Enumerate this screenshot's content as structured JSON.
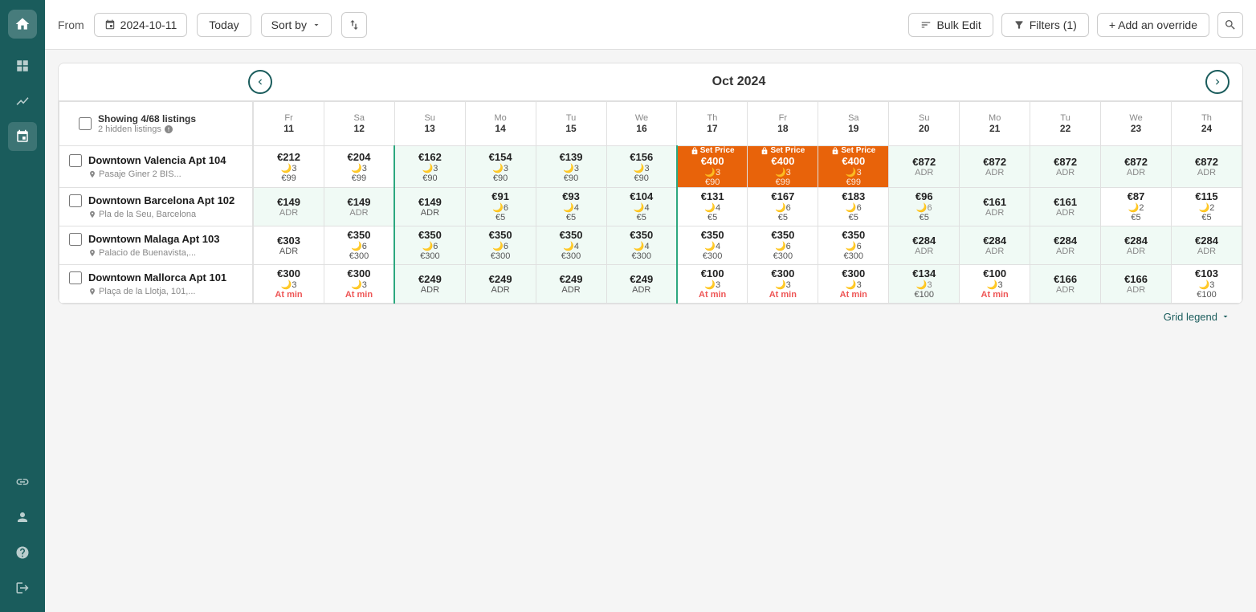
{
  "sidebar": {
    "logo_icon": "home-icon",
    "items": [
      {
        "name": "dashboard-icon",
        "icon": "⊞",
        "active": false
      },
      {
        "name": "chart-icon",
        "icon": "📈",
        "active": false
      },
      {
        "name": "calendar-icon",
        "icon": "📅",
        "active": true
      },
      {
        "name": "link-icon",
        "icon": "🔗",
        "active": false
      },
      {
        "name": "user-icon",
        "icon": "👤",
        "active": false
      },
      {
        "name": "help-icon",
        "icon": "?",
        "active": false
      },
      {
        "name": "logout-icon",
        "icon": "→",
        "active": false
      }
    ]
  },
  "topbar": {
    "from_label": "From",
    "date_value": "2024-10-11",
    "today_label": "Today",
    "sort_by_label": "Sort by",
    "bulk_edit_label": "Bulk Edit",
    "filters_label": "Filters (1)",
    "add_override_label": "+ Add an override"
  },
  "calendar": {
    "month_title": "Oct 2024",
    "days": [
      {
        "name": "Fr",
        "num": "11"
      },
      {
        "name": "Sa",
        "num": "12"
      },
      {
        "name": "Su",
        "num": "13"
      },
      {
        "name": "Mo",
        "num": "14"
      },
      {
        "name": "Tu",
        "num": "15"
      },
      {
        "name": "We",
        "num": "16"
      },
      {
        "name": "Th",
        "num": "17"
      },
      {
        "name": "Fr",
        "num": "18"
      },
      {
        "name": "Sa",
        "num": "19"
      },
      {
        "name": "Su",
        "num": "20"
      },
      {
        "name": "Mo",
        "num": "21"
      },
      {
        "name": "Tu",
        "num": "22"
      },
      {
        "name": "We",
        "num": "23"
      },
      {
        "name": "Th",
        "num": "24"
      }
    ],
    "listing_header": "Showing 4/68 listings",
    "listing_subheader": "2 hidden listings",
    "listings": [
      {
        "id": "valencia-104",
        "name": "Downtown Valencia Apt 104",
        "address": "Pasaje Giner 2 BIS...",
        "prices": [
          {
            "main": "€212",
            "sub": "🌙3",
            "third": "€99",
            "type": "normal"
          },
          {
            "main": "€204",
            "sub": "🌙3",
            "third": "€99",
            "type": "normal"
          },
          {
            "main": "€162",
            "sub": "🌙3",
            "third": "€90",
            "type": "period"
          },
          {
            "main": "€154",
            "sub": "🌙3",
            "third": "€90",
            "type": "period"
          },
          {
            "main": "€139",
            "sub": "🌙3",
            "third": "€90",
            "type": "period"
          },
          {
            "main": "€156",
            "sub": "🌙3",
            "third": "€90",
            "type": "period"
          },
          {
            "main": "€400",
            "sub": "🌙3",
            "third": "€90",
            "type": "setprice",
            "label": "Set Price"
          },
          {
            "main": "€400",
            "sub": "🌙3",
            "third": "€99",
            "type": "setprice",
            "label": "Set Price"
          },
          {
            "main": "€400",
            "sub": "🌙3",
            "third": "€99",
            "type": "setprice",
            "label": "Set Price"
          },
          {
            "main": "€872",
            "sub": "ADR",
            "third": "",
            "type": "adr"
          },
          {
            "main": "€872",
            "sub": "ADR",
            "third": "",
            "type": "adr"
          },
          {
            "main": "€872",
            "sub": "ADR",
            "third": "",
            "type": "adr"
          },
          {
            "main": "€872",
            "sub": "ADR",
            "third": "",
            "type": "adr"
          },
          {
            "main": "€872",
            "sub": "ADR",
            "third": "",
            "type": "adr"
          }
        ]
      },
      {
        "id": "barcelona-102",
        "name": "Downtown Barcelona Apt 102",
        "address": "Pla de la Seu, Barcelona",
        "prices": [
          {
            "main": "€149",
            "sub": "ADR",
            "third": "",
            "type": "adr"
          },
          {
            "main": "€149",
            "sub": "ADR",
            "third": "",
            "type": "adr"
          },
          {
            "main": "€149",
            "sub": "ADR",
            "third": "",
            "type": "period"
          },
          {
            "main": "€91",
            "sub": "🌙6",
            "third": "€5",
            "type": "period"
          },
          {
            "main": "€93",
            "sub": "🌙4",
            "third": "€5",
            "type": "period"
          },
          {
            "main": "€104",
            "sub": "🌙4",
            "third": "€5",
            "type": "period"
          },
          {
            "main": "€131",
            "sub": "🌙4",
            "third": "€5",
            "type": "normal"
          },
          {
            "main": "€167",
            "sub": "🌙6",
            "third": "€5",
            "type": "normal"
          },
          {
            "main": "€183",
            "sub": "🌙6",
            "third": "€5",
            "type": "normal"
          },
          {
            "main": "€96",
            "sub": "🌙6",
            "third": "€5",
            "type": "adr"
          },
          {
            "main": "€161",
            "sub": "ADR",
            "third": "",
            "type": "adr"
          },
          {
            "main": "€161",
            "sub": "ADR",
            "third": "",
            "type": "adr"
          },
          {
            "main": "€87",
            "sub": "🌙2",
            "third": "€5",
            "type": "normal"
          },
          {
            "main": "€115",
            "sub": "🌙2",
            "third": "€5",
            "type": "normal"
          }
        ]
      },
      {
        "id": "malaga-103",
        "name": "Downtown Malaga Apt 103",
        "address": "Palacio de Buenavista,...",
        "prices": [
          {
            "main": "€303",
            "sub": "ADR",
            "third": "",
            "type": "normal"
          },
          {
            "main": "€350",
            "sub": "🌙6",
            "third": "€300",
            "type": "normal"
          },
          {
            "main": "€350",
            "sub": "🌙6",
            "third": "€300",
            "type": "period"
          },
          {
            "main": "€350",
            "sub": "🌙6",
            "third": "€300",
            "type": "period"
          },
          {
            "main": "€350",
            "sub": "🌙4",
            "third": "€300",
            "type": "period"
          },
          {
            "main": "€350",
            "sub": "🌙4",
            "third": "€300",
            "type": "period"
          },
          {
            "main": "€350",
            "sub": "🌙4",
            "third": "€300",
            "type": "normal"
          },
          {
            "main": "€350",
            "sub": "🌙6",
            "third": "€300",
            "type": "normal"
          },
          {
            "main": "€350",
            "sub": "🌙6",
            "third": "€300",
            "type": "normal"
          },
          {
            "main": "€284",
            "sub": "ADR",
            "third": "",
            "type": "adr"
          },
          {
            "main": "€284",
            "sub": "ADR",
            "third": "",
            "type": "adr"
          },
          {
            "main": "€284",
            "sub": "ADR",
            "third": "",
            "type": "adr"
          },
          {
            "main": "€284",
            "sub": "ADR",
            "third": "",
            "type": "adr"
          },
          {
            "main": "€284",
            "sub": "ADR",
            "third": "",
            "type": "adr"
          }
        ]
      },
      {
        "id": "mallorca-101",
        "name": "Downtown Mallorca Apt 101",
        "address": "Plaça de la Llotja, 101,...",
        "prices": [
          {
            "main": "€300",
            "sub": "🌙3",
            "third": "At min",
            "type": "atmin"
          },
          {
            "main": "€300",
            "sub": "🌙3",
            "third": "At min",
            "type": "atmin"
          },
          {
            "main": "€249",
            "sub": "ADR",
            "third": "",
            "type": "period"
          },
          {
            "main": "€249",
            "sub": "ADR",
            "third": "",
            "type": "period"
          },
          {
            "main": "€249",
            "sub": "ADR",
            "third": "",
            "type": "period"
          },
          {
            "main": "€249",
            "sub": "ADR",
            "third": "",
            "type": "period"
          },
          {
            "main": "€100",
            "sub": "🌙3",
            "third": "At min",
            "type": "atmin"
          },
          {
            "main": "€300",
            "sub": "🌙3",
            "third": "At min",
            "type": "atmin"
          },
          {
            "main": "€300",
            "sub": "🌙3",
            "third": "At min",
            "type": "atmin"
          },
          {
            "main": "€134",
            "sub": "🌙3",
            "third": "€100",
            "type": "adr"
          },
          {
            "main": "€100",
            "sub": "🌙3",
            "third": "At min",
            "type": "atmin"
          },
          {
            "main": "€166",
            "sub": "ADR",
            "third": "",
            "type": "adr"
          },
          {
            "main": "€166",
            "sub": "ADR",
            "third": "",
            "type": "adr"
          },
          {
            "main": "€103",
            "sub": "🌙3",
            "third": "€100",
            "type": "normal"
          }
        ]
      }
    ]
  },
  "bottom": {
    "grid_legend_label": "Grid legend"
  }
}
